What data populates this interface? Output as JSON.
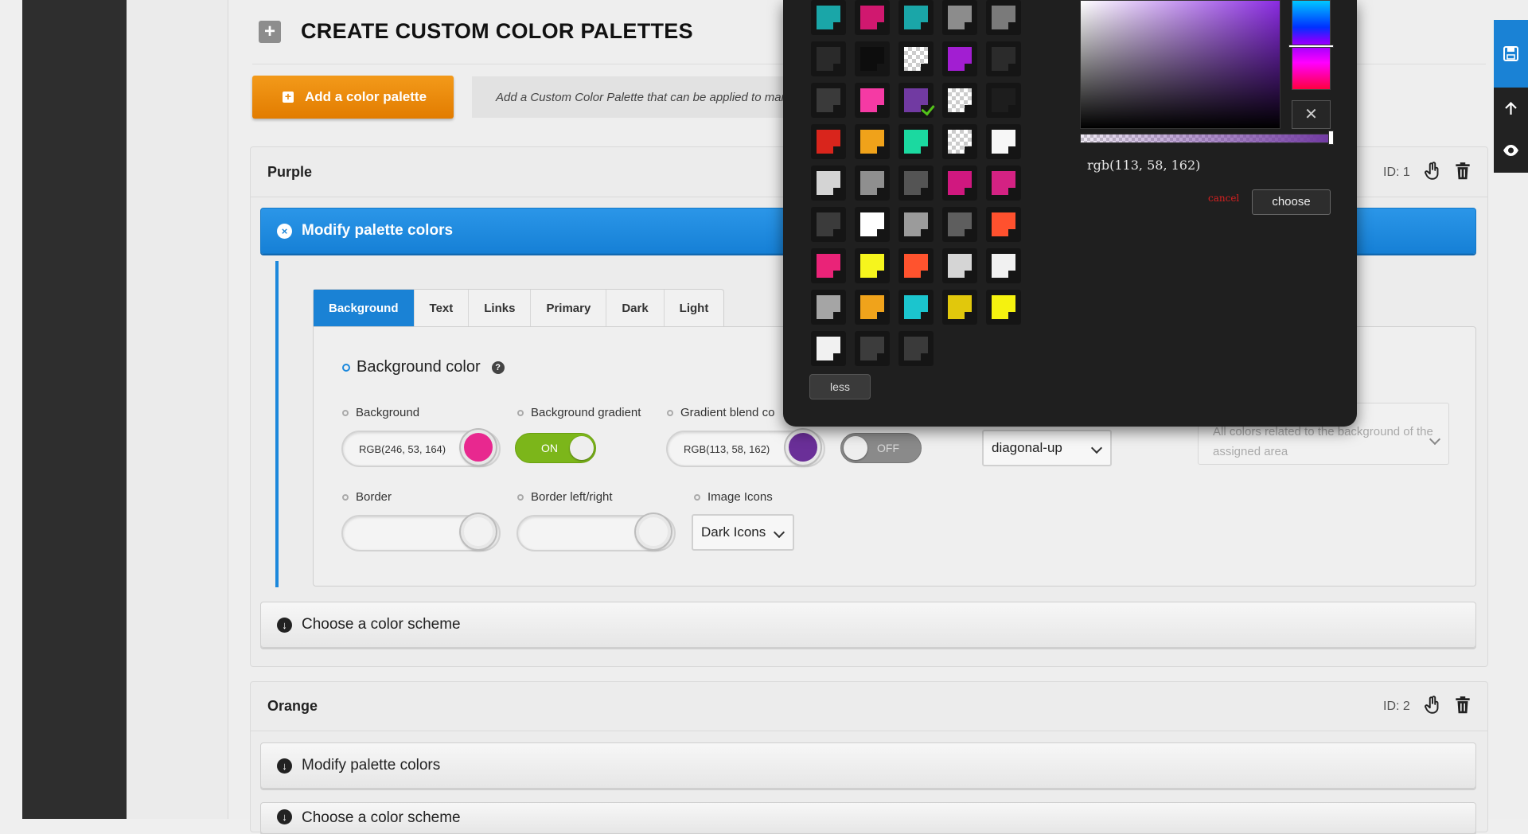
{
  "header": {
    "title": "CREATE CUSTOM COLOR PALETTES",
    "add_button_label": "Add a color palette",
    "add_hint": "Add a Custom Color Palette that can be applied to man"
  },
  "palettes": [
    {
      "name": "Purple",
      "id_label": "ID: 1",
      "accordions": {
        "modify": "Modify palette colors",
        "scheme": "Choose a color scheme"
      },
      "tabs": [
        "Background",
        "Text",
        "Links",
        "Primary",
        "Dark",
        "Light"
      ],
      "active_tab": "Background",
      "section_heading": "Background color",
      "fields": {
        "background_label": "Background",
        "background_value": "RGB(246, 53, 164)",
        "gradient_label": "Background gradient",
        "gradient_state": "ON",
        "blend_label": "Gradient blend co",
        "blend_value": "RGB(113, 58, 162)",
        "blend_toggle_state": "OFF",
        "direction_value": "diagonal-up",
        "description_text": "All colors related to the background of the assigned area",
        "border_label": "Border",
        "border_lr_label": "Border left/right",
        "image_icons_label": "Image Icons",
        "image_icons_value": "Dark Icons"
      }
    },
    {
      "name": "Orange",
      "id_label": "ID: 2",
      "accordions": {
        "modify": "Modify palette colors",
        "scheme": "Choose a color scheme"
      }
    }
  ],
  "picker": {
    "swatches": [
      [
        "#1aa6a8",
        "#d0186f",
        "#1aa6a8",
        "#8c8c8c",
        "#7a7a7a"
      ],
      [
        "#2a2a2a",
        "#0d0d0d",
        "checker",
        "#a21ed2",
        "#2b2b2b"
      ],
      [
        "#3a3a3a",
        "#f53aa4",
        "#713aa2",
        "checker",
        "#1d1d1d"
      ],
      [
        "#d9251c",
        "#f0a21a",
        "#1bd9a0",
        "checker",
        "#f7f7f7"
      ],
      [
        "#d4d4d4",
        "#8f8f8f",
        "#545454",
        "#d0187f",
        "#d42283"
      ],
      [
        "#3b3b3b",
        "#ffffff",
        "#9b9b9b",
        "#5e5e5e",
        "#ff512e"
      ],
      [
        "#ea2378",
        "#f6f51d",
        "#ff532e",
        "#d5d5d5",
        "#f1f1f1"
      ],
      [
        "#a5a5a5",
        "#f0a31b",
        "#1bc5ce",
        "#e1c80c",
        "#f5f20f"
      ],
      [
        "#f1f1f1",
        "#3c3c3c",
        "#3a3a3a"
      ]
    ],
    "less_label": "less",
    "close_symbol": "✕",
    "rgb_readout": "rgb(113, 58, 162)",
    "cancel_label": "cancel",
    "choose_label": "choose"
  },
  "colors": {
    "accent_blue": "#1a82d5",
    "orange": "#f39a1a",
    "toggle_on": "#7cb61a",
    "bg_swatch": "#e8288f",
    "blend_swatch": "#6a2f98"
  },
  "icons": {
    "plus": "plus-icon",
    "close": "close-circle-icon",
    "help": "help-icon",
    "duplicate": "hand-pointer-icon",
    "delete": "trash-icon",
    "save": "save-icon",
    "up": "arrow-up-icon",
    "preview": "eye-icon"
  }
}
